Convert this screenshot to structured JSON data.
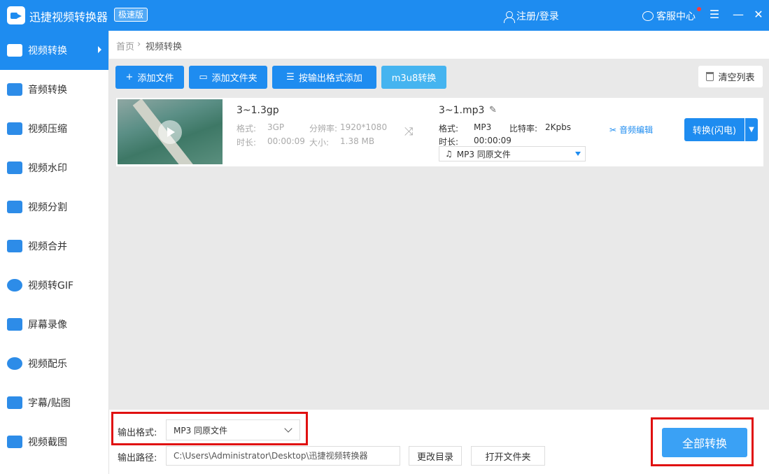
{
  "app": {
    "title": "迅捷视频转换器",
    "edition": "极速版",
    "login": "注册/登录",
    "service": "客服中心",
    "menu_glyph": "☰",
    "minimize_glyph": "—",
    "close_glyph": "✕"
  },
  "sidebar": {
    "items": [
      {
        "label": "视频转换",
        "icon": "video-convert-icon",
        "active": true
      },
      {
        "label": "音频转换",
        "icon": "audio-convert-icon"
      },
      {
        "label": "视频压缩",
        "icon": "video-compress-icon"
      },
      {
        "label": "视频水印",
        "icon": "video-watermark-icon"
      },
      {
        "label": "视频分割",
        "icon": "video-split-icon"
      },
      {
        "label": "视频合并",
        "icon": "video-merge-icon"
      },
      {
        "label": "视频转GIF",
        "icon": "video-gif-icon"
      },
      {
        "label": "屏幕录像",
        "icon": "screen-record-icon"
      },
      {
        "label": "视频配乐",
        "icon": "video-music-icon"
      },
      {
        "label": "字幕/贴图",
        "icon": "subtitle-sticker-icon"
      },
      {
        "label": "视频截图",
        "icon": "video-screenshot-icon"
      }
    ],
    "accent": "#1e8cf0"
  },
  "breadcrumb": {
    "home": "首页",
    "sep": "›",
    "current": "视频转换"
  },
  "toolbar": {
    "add_file": "添加文件",
    "add_folder": "添加文件夹",
    "add_by_format": "按输出格式添加",
    "m3u8": "m3u8转换",
    "clear_list": "清空列表"
  },
  "file": {
    "source_name": "3~1.3gp",
    "format_label": "格式:",
    "format_value": "3GP",
    "resolution_label": "分辨率:",
    "resolution_value": "1920*1080",
    "duration_label": "时长:",
    "duration_value": "00:00:09",
    "size_label": "大小:",
    "size_value": "1.38 MB",
    "output_name": "3~1.mp3",
    "out_format_label": "格式:",
    "out_format_value": "MP3",
    "bitrate_label": "比特率:",
    "bitrate_value": "2Kpbs",
    "out_duration_label": "时长:",
    "out_duration_value": "00:00:09",
    "select_value": "MP3  同原文件",
    "audio_edit": "音频编辑",
    "convert_button": "转换(闪电)"
  },
  "bottom": {
    "output_format_label": "输出格式:",
    "output_format_value": "MP3  同原文件",
    "output_path_label": "输出路径:",
    "output_path_value": "C:\\Users\\Administrator\\Desktop\\迅捷视频转换器",
    "change_dir": "更改目录",
    "open_folder": "打开文件夹",
    "convert_all": "全部转换"
  },
  "colors": {
    "primary": "#1e8cf0",
    "highlight_box": "#e01010"
  }
}
